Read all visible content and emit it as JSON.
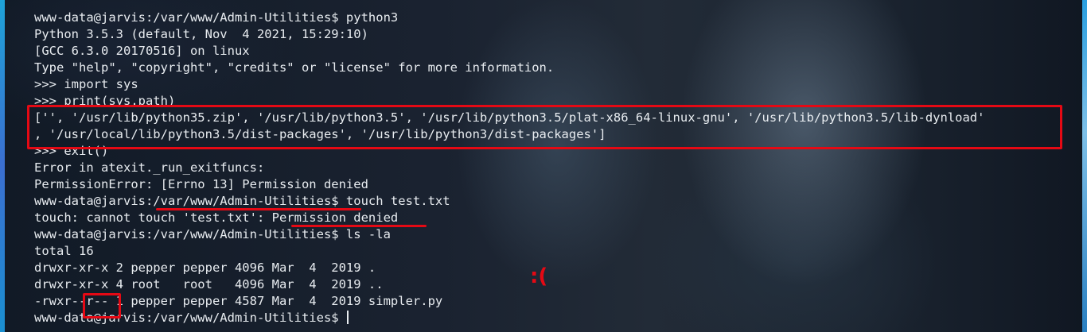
{
  "terminal": {
    "lines": [
      "www-data@jarvis:/var/www/Admin-Utilities$ python3",
      "Python 3.5.3 (default, Nov  4 2021, 15:29:10)",
      "[GCC 6.3.0 20170516] on linux",
      "Type \"help\", \"copyright\", \"credits\" or \"license\" for more information.",
      ">>> import sys",
      ">>> print(sys.path)",
      "['', '/usr/lib/python35.zip', '/usr/lib/python3.5', '/usr/lib/python3.5/plat-x86_64-linux-gnu', '/usr/lib/python3.5/lib-dynload'",
      ", '/usr/local/lib/python3.5/dist-packages', '/usr/lib/python3/dist-packages']",
      ">>> exit()",
      "Error in atexit._run_exitfuncs:",
      "PermissionError: [Errno 13] Permission denied",
      "www-data@jarvis:/var/www/Admin-Utilities$ touch test.txt",
      "touch: cannot touch 'test.txt': Permission denied",
      "www-data@jarvis:/var/www/Admin-Utilities$ ls -la",
      "total 16",
      "drwxr-xr-x 2 pepper pepper 4096 Mar  4  2019 .",
      "drwxr-xr-x 4 root   root   4096 Mar  4  2019 ..",
      "-rwxr--r-- 1 pepper pepper 4587 Mar  4  2019 simpler.py",
      "www-data@jarvis:/var/www/Admin-Utilities$ "
    ]
  },
  "annotations": {
    "sad_face": ":(",
    "color": "#e50914"
  },
  "colors": {
    "text": "#e8ecf0",
    "background": "#0d141f"
  }
}
